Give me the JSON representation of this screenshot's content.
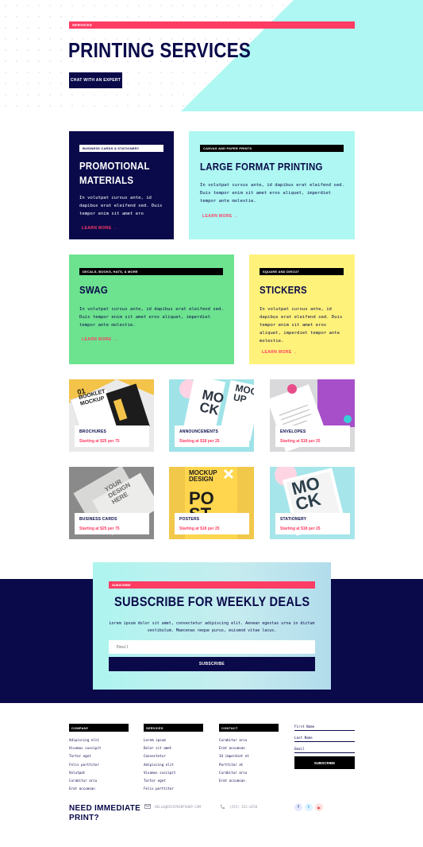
{
  "hero": {
    "tag": "SERVICES",
    "title": "PRINTING SERVICES",
    "cta": "CHAT WITH AN EXPERT"
  },
  "cards": [
    {
      "tag": "BUSINESS CARDS & STATIONERY",
      "title_line1": "PROMOTIONAL",
      "title_line2": "MATERIALS",
      "body": "In volutpat cursus ante, id dapibus erat eleifend sed. Duis tempor enim sit amet ero",
      "more": "LEARN MORE →"
    },
    {
      "tag": "CANVAS AND PAPER PRINTS",
      "title": "LARGE FORMAT PRINTING",
      "body": "In volutpat cursus ante, id dapibus erat eleifend sed. Duis tempor enim sit amet eros aliquet, imperdiet tempor ante molestie.",
      "more": "LEARN MORE →"
    },
    {
      "tag": "DECALS, BOOKS, HATS, & MORE",
      "title": "SWAG",
      "body": "In volutpat cursus ante, id dapibus erat eleifend sed. Duis tempor enim sit amet eros aliquet, imperdiet tempor ante molestie.",
      "more": "LEARN MORE →"
    },
    {
      "tag": "SQUARE AND DIECUT",
      "title": "STICKERS",
      "body": "In volutpat cursus ante, id dapibus erat eleifend sed. Duis tempor enim sit amet eros aliquet, imperdiet tempor ante molestie.",
      "more": "LEARN MORE →"
    }
  ],
  "products": [
    {
      "name": "BROCHURES",
      "price": "Starting at $25 per 75"
    },
    {
      "name": "ANNOUNCEMENTS",
      "price": "Starting at $18 per 25"
    },
    {
      "name": "ENVELOPES",
      "price": "Starting at $18 per 25"
    },
    {
      "name": "BUSINESS CARDS",
      "price": "Starting at $25 per 75"
    },
    {
      "name": "POSTERS",
      "price": "Starting at $18 per 25"
    },
    {
      "name": "STATIONERY",
      "price": "Starting at $18 per 25"
    }
  ],
  "tile_art": {
    "booklet_1": "01",
    "booklet_2": "BOOKLET",
    "booklet_3": "MOCKUP",
    "mock_1": "MO",
    "mock_2": "CK",
    "mock_3": "UP",
    "mock_side_1": "MOCK",
    "mock_side_2": "UP",
    "poster_1": "MOCKUP",
    "poster_2": "DESIGN",
    "poster_big": "PO",
    "poster_big2": "ST",
    "card_1": "YOUR",
    "card_2": "DESIGN",
    "card_3": "HERE",
    "stat_1": "MO",
    "stat_2": "CK"
  },
  "subscribe": {
    "tag": "SUBSCRIBE",
    "title": "SUBSCRIBE FOR WEEKLY DEALS",
    "text": "Lorem ipsum dolor sit amet, consectetur adipiscing elit. Aenean egestas urna in dictum vestibulum. Maecenas neque purus, euismod vitae lacus.",
    "placeholder": "Email",
    "button": "SUBSCRIBE"
  },
  "footer": {
    "company": {
      "title": "COMPANY",
      "links": [
        "Adipiscing elit",
        "Vivamus suscipit",
        "Tortor eget",
        "Felis porttitor",
        "Volutpat",
        "Curabitur arcu",
        "Erat accumsan"
      ]
    },
    "services": {
      "title": "SERVICES",
      "links": [
        "Lorem ipsum",
        "Dolor sit amet",
        "Consectetur",
        "Adipiscing elit",
        "Vivamus suscipit",
        "Tortor eget",
        "Felis porttitor"
      ]
    },
    "contact": {
      "title": "CONTACT",
      "links": [
        "Curabitur arcu",
        "Erat accumsan",
        "Id imperdiet et",
        "Porttitor at",
        "Curabitur arcu",
        "Erat accumsan"
      ]
    },
    "form": {
      "first_name": "First Name",
      "last_name": "Last Name",
      "email": "Email",
      "button": "SUBSCRIBE"
    },
    "need_line1": "NEED IMMEDIATE",
    "need_line2": "PRINT?",
    "email": "HELLO@DIVIPRINTSHOP.COM",
    "phone": "(255) 352-6258",
    "social": [
      {
        "icon": "facebook-icon",
        "glyph": "f"
      },
      {
        "icon": "twitter-icon",
        "glyph": "t"
      },
      {
        "icon": "youtube-icon",
        "glyph": "▶"
      }
    ]
  },
  "colors": {
    "navy": "#0a0a4a",
    "pink": "#ff3c63",
    "cyan": "#aef7f2",
    "green": "#6de28f",
    "yellow": "#fff27a"
  }
}
